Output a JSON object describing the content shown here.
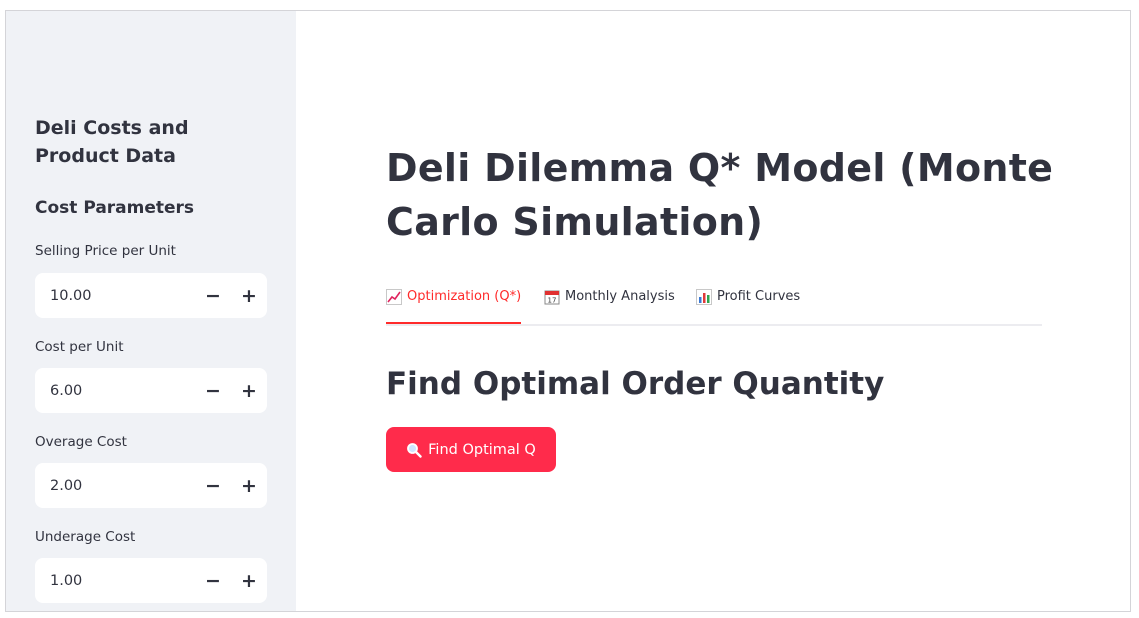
{
  "sidebar": {
    "heading": "Deli Costs and Product Data",
    "subheading": "Cost Parameters",
    "fields": [
      {
        "label": "Selling Price per Unit",
        "value": "10.00",
        "minus": "−",
        "plus": "+"
      },
      {
        "label": "Cost per Unit",
        "value": "6.00",
        "minus": "−",
        "plus": "+"
      },
      {
        "label": "Overage Cost",
        "value": "2.00",
        "minus": "−",
        "plus": "+"
      },
      {
        "label": "Underage Cost",
        "value": "1.00",
        "minus": "−",
        "plus": "+"
      }
    ]
  },
  "main": {
    "title": "Deli Dilemma Q* Model (Monte Carlo Simulation)",
    "tabs": [
      {
        "label": "Optimization (Q*)",
        "icon": "chart-increasing-icon",
        "active": true
      },
      {
        "label": "Monthly Analysis",
        "icon": "calendar-icon",
        "active": false
      },
      {
        "label": "Profit Curves",
        "icon": "bar-chart-icon",
        "active": false
      }
    ],
    "section_title": "Find Optimal Order Quantity",
    "button": {
      "label": "Find Optimal Q",
      "icon": "magnifying-glass-icon"
    }
  },
  "colors": {
    "accent": "#ff2b4b",
    "sidebar_bg": "#f0f2f6",
    "text": "#31333f"
  }
}
